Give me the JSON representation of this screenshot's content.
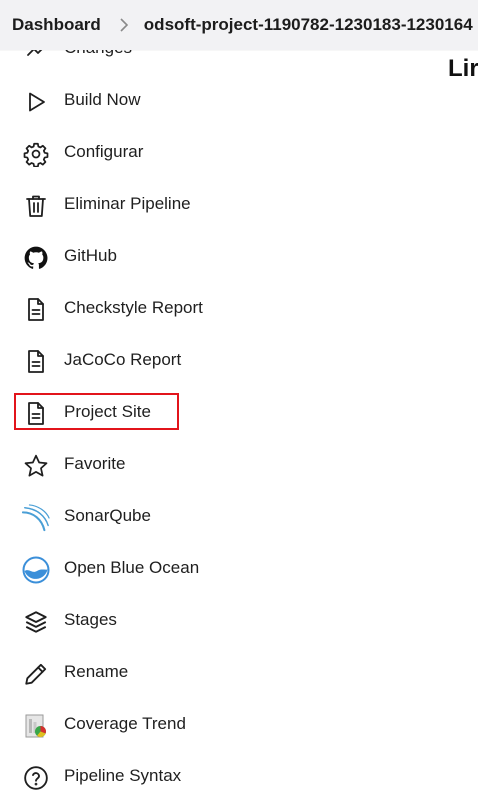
{
  "breadcrumb": {
    "home": "Dashboard",
    "project": "odsoft-project-1190782-1230183-1230164"
  },
  "page_heading": "Lir",
  "sidebar": {
    "items": [
      {
        "label": "Changes",
        "icon": "changes-icon"
      },
      {
        "label": "Build Now",
        "icon": "play-icon"
      },
      {
        "label": "Configurar",
        "icon": "gear-icon"
      },
      {
        "label": "Eliminar Pipeline",
        "icon": "trash-icon"
      },
      {
        "label": "GitHub",
        "icon": "github-icon"
      },
      {
        "label": "Checkstyle Report",
        "icon": "document-icon"
      },
      {
        "label": "JaCoCo Report",
        "icon": "document-icon"
      },
      {
        "label": "Project Site",
        "icon": "document-icon"
      },
      {
        "label": "Favorite",
        "icon": "star-icon"
      },
      {
        "label": "SonarQube",
        "icon": "sonarqube-icon"
      },
      {
        "label": "Open Blue Ocean",
        "icon": "blue-ocean-icon"
      },
      {
        "label": "Stages",
        "icon": "stages-icon"
      },
      {
        "label": "Rename",
        "icon": "pencil-icon"
      },
      {
        "label": "Coverage Trend",
        "icon": "coverage-trend-icon"
      },
      {
        "label": "Pipeline Syntax",
        "icon": "help-icon"
      }
    ]
  },
  "colors": {
    "highlight_border": "#e2141b",
    "breadcrumb_bg": "#f2f2f4",
    "sonarqube_blue": "#4a9fd6",
    "blue_ocean": "#3b8fd9"
  }
}
